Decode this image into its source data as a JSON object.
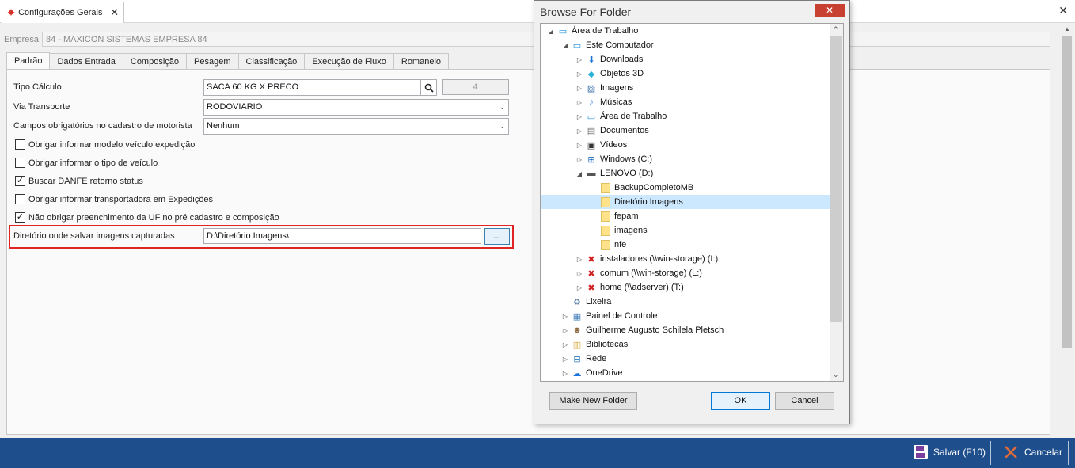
{
  "doc_tab": {
    "title": "Configurações Gerais"
  },
  "form": {
    "empresa_label": "Empresa",
    "empresa_value": "84 - MAXICON SISTEMAS EMPRESA 84",
    "tabs": [
      "Padrão",
      "Dados Entrada",
      "Composição",
      "Pesagem",
      "Classificação",
      "Execução de Fluxo",
      "Romaneio"
    ],
    "tipo_calculo_label": "Tipo Cálculo",
    "tipo_calculo_value": "SACA 60 KG X PRECO",
    "tipo_calculo_code": "4",
    "via_transporte_label": "Via Transporte",
    "via_transporte_value": "RODOVIARIO",
    "campos_label": "Campos obrigatórios no cadastro de motorista",
    "campos_value": "Nenhum",
    "checkboxes": [
      {
        "label": "Obrigar informar modelo veículo expedição",
        "checked": false
      },
      {
        "label": "Obrigar informar o tipo de veículo",
        "checked": false
      },
      {
        "label": "Buscar DANFE retorno status",
        "checked": true
      },
      {
        "label": "Obrigar informar transportadora em Expedições",
        "checked": false
      },
      {
        "label": "Não obrigar preenchimento da UF no pré cadastro e composição",
        "checked": true
      }
    ],
    "diretorio_label": "Diretório onde salvar imagens capturadas",
    "diretorio_value": "D:\\Diretório Imagens\\",
    "browse_label": "..."
  },
  "bottom": {
    "save_label": "Salvar (F10)",
    "cancel_label": "Cancelar"
  },
  "dialog": {
    "title": "Browse For Folder",
    "close": "✕",
    "tree": [
      {
        "label": "Área de Trabalho",
        "level": 0,
        "exp": "◢",
        "icon": "desktop-icon"
      },
      {
        "label": "Este Computador",
        "level": 1,
        "exp": "◢",
        "icon": "computer-icon"
      },
      {
        "label": "Downloads",
        "level": 2,
        "exp": "▷",
        "icon": "download-icon"
      },
      {
        "label": "Objetos 3D",
        "level": 2,
        "exp": "▷",
        "icon": "cube-icon"
      },
      {
        "label": "Imagens",
        "level": 2,
        "exp": "▷",
        "icon": "image-icon"
      },
      {
        "label": "Músicas",
        "level": 2,
        "exp": "▷",
        "icon": "music-icon"
      },
      {
        "label": "Área de Trabalho",
        "level": 2,
        "exp": "▷",
        "icon": "desktop-icon"
      },
      {
        "label": "Documentos",
        "level": 2,
        "exp": "▷",
        "icon": "document-icon"
      },
      {
        "label": "Vídeos",
        "level": 2,
        "exp": "▷",
        "icon": "video-icon"
      },
      {
        "label": "Windows (C:)",
        "level": 2,
        "exp": "▷",
        "icon": "windows-drive-icon"
      },
      {
        "label": "LENOVO (D:)",
        "level": 2,
        "exp": "◢",
        "icon": "drive-icon"
      },
      {
        "label": "BackupCompletoMB",
        "level": 3,
        "exp": "",
        "icon": "folder-icon"
      },
      {
        "label": "Diretório Imagens",
        "level": 3,
        "exp": "",
        "icon": "folder-icon",
        "selected": true
      },
      {
        "label": "fepam",
        "level": 3,
        "exp": "",
        "icon": "folder-icon"
      },
      {
        "label": "imagens",
        "level": 3,
        "exp": "",
        "icon": "folder-icon"
      },
      {
        "label": "nfe",
        "level": 3,
        "exp": "",
        "icon": "folder-icon"
      },
      {
        "label": "instaladores (\\\\win-storage) (I:)",
        "level": 2,
        "exp": "▷",
        "icon": "network-drive-disconnected-icon"
      },
      {
        "label": "comum (\\\\win-storage) (L:)",
        "level": 2,
        "exp": "▷",
        "icon": "network-drive-disconnected-icon"
      },
      {
        "label": "home (\\\\adserver) (T:)",
        "level": 2,
        "exp": "▷",
        "icon": "network-drive-disconnected-icon"
      },
      {
        "label": "Lixeira",
        "level": 1,
        "exp": "",
        "icon": "recycle-bin-icon"
      },
      {
        "label": "Painel de Controle",
        "level": 1,
        "exp": "▷",
        "icon": "control-panel-icon"
      },
      {
        "label": "Guilherme Augusto Schilela Pletsch",
        "level": 1,
        "exp": "▷",
        "icon": "user-icon"
      },
      {
        "label": "Bibliotecas",
        "level": 1,
        "exp": "▷",
        "icon": "library-icon"
      },
      {
        "label": "Rede",
        "level": 1,
        "exp": "▷",
        "icon": "network-icon"
      },
      {
        "label": "OneDrive",
        "level": 1,
        "exp": "▷",
        "icon": "cloud-icon"
      }
    ],
    "new_folder_label": "Make New Folder",
    "ok_label": "OK",
    "cancel_label": "Cancel"
  }
}
